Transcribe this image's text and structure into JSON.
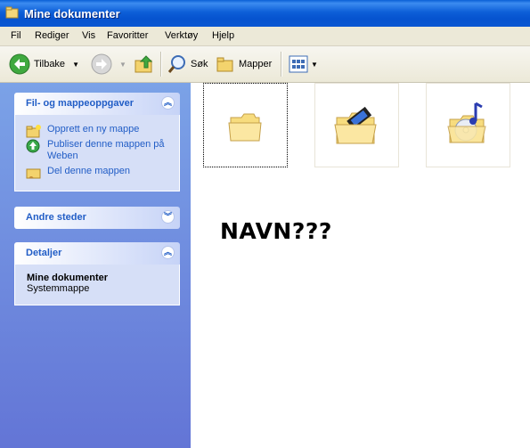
{
  "window": {
    "title": "Mine dokumenter"
  },
  "menu": [
    "Fil",
    "Rediger",
    "Vis",
    "Favoritter",
    "Verktøy",
    "Hjelp"
  ],
  "toolbar": {
    "back_label": "Tilbake",
    "search_label": "Søk",
    "folders_label": "Mapper"
  },
  "sidebar": {
    "tasks": {
      "title": "Fil- og mappeoppgaver",
      "items": [
        {
          "label": "Opprett en ny mappe",
          "icon": "new-folder-icon"
        },
        {
          "label_line1": "Publiser denne mappen på",
          "label_line2": "Weben",
          "icon": "publish-web-icon"
        },
        {
          "label": "Del denne mappen",
          "icon": "share-folder-icon"
        }
      ]
    },
    "other_places": {
      "title": "Andre steder"
    },
    "details": {
      "title": "Detaljer",
      "name": "Mine dokumenter",
      "type": "Systemmappe"
    }
  },
  "content": {
    "folders": [
      {
        "icon": "folder-icon",
        "selected": true
      },
      {
        "icon": "my-videos-folder-icon",
        "selected": false
      },
      {
        "icon": "my-music-folder-icon",
        "selected": false
      }
    ],
    "overlay_text": "NAVN???"
  },
  "colors": {
    "titlebar": "#0a5fd6",
    "sidebar": "#6f8fe0",
    "link": "#215dc6"
  }
}
